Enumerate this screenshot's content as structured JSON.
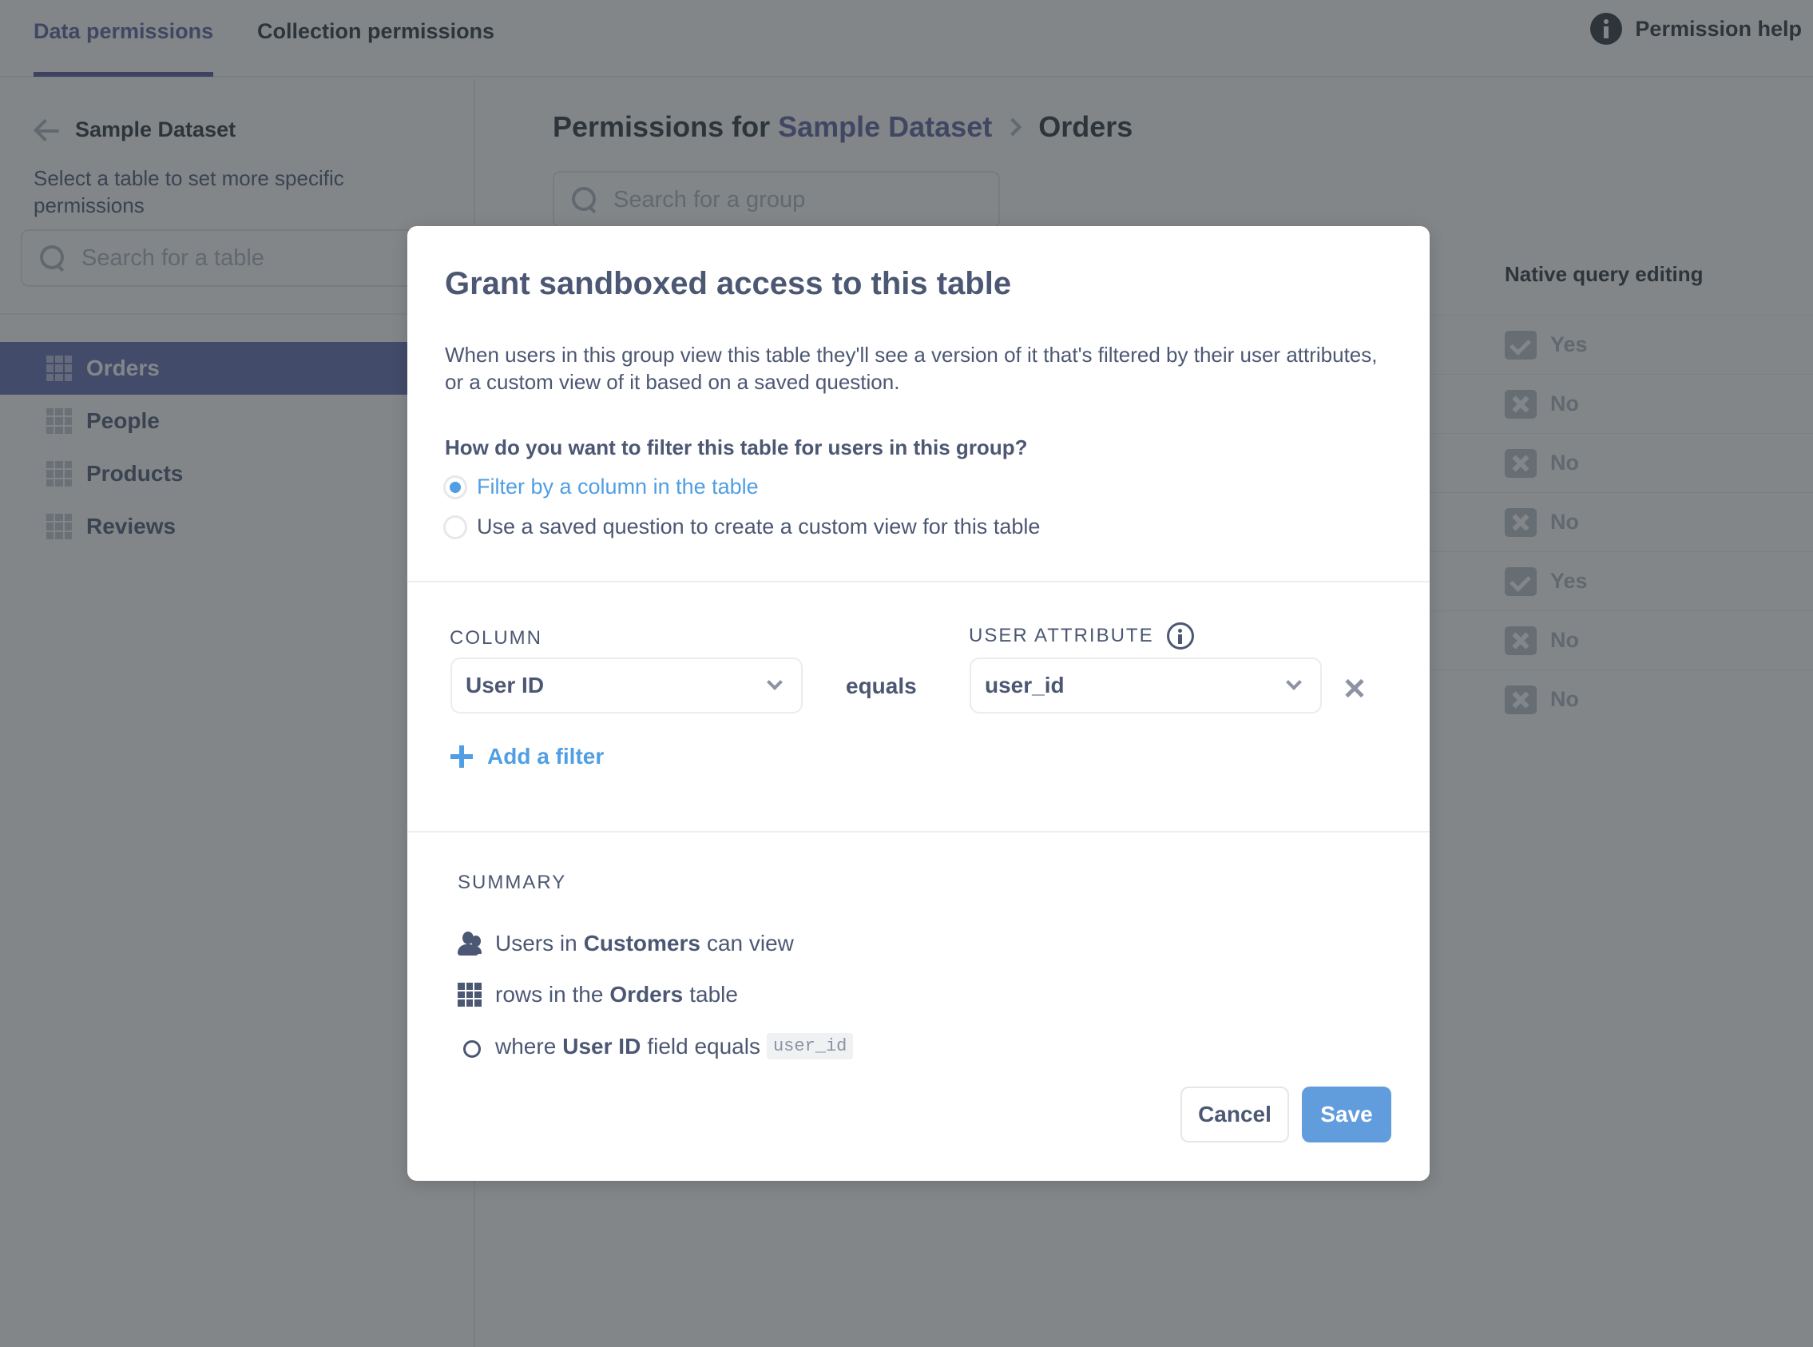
{
  "topnav": {
    "tabs": [
      {
        "label": "Data permissions",
        "active": true
      },
      {
        "label": "Collection permissions",
        "active": false
      }
    ],
    "help_label": "Permission help",
    "help_icon": "info-icon"
  },
  "sidebar": {
    "back_label": "Sample Dataset",
    "description": "Select a table to set more specific permissions",
    "search_placeholder": "Search for a table",
    "tables": [
      {
        "label": "Orders",
        "active": true,
        "icon": "table-grid-icon"
      },
      {
        "label": "People",
        "active": false,
        "icon": "table-grid-icon"
      },
      {
        "label": "Products",
        "active": false,
        "icon": "table-grid-icon"
      },
      {
        "label": "Reviews",
        "active": false,
        "icon": "table-grid-icon"
      }
    ]
  },
  "main": {
    "title_prefix": "Permissions for",
    "title_database": "Sample Dataset",
    "title_table": "Orders",
    "group_search_placeholder": "Search for a group",
    "column_header": "Native query editing",
    "native_query_values": [
      "Yes",
      "No",
      "No",
      "No",
      "Yes",
      "No",
      "No"
    ]
  },
  "modal": {
    "title": "Grant sandboxed access to this table",
    "description": "When users in this group view this table they'll see a version of it that's filtered by their user attributes, or a custom view of it based on a saved question.",
    "question": "How do you want to filter this table for users in this group?",
    "options": [
      {
        "label": "Filter by a column in the table",
        "selected": true
      },
      {
        "label": "Use a saved question to create a custom view for this table",
        "selected": false
      }
    ],
    "column_label": "COLUMN",
    "column_value": "User ID",
    "operator": "equals",
    "user_attribute_label": "USER ATTRIBUTE",
    "user_attribute_value": "user_id",
    "add_filter_label": "Add a filter",
    "summary_label": "SUMMARY",
    "summary": {
      "row1_pre": "Users in",
      "row1_bold": "Customers",
      "row1_post": "can view",
      "row2_pre": "rows in the",
      "row2_bold": "Orders",
      "row2_post": "table",
      "row3_pre": "where",
      "row3_bold": "User ID",
      "row3_post": "field equals",
      "row3_code": "user_id"
    },
    "cancel_label": "Cancel",
    "save_label": "Save"
  },
  "colors": {
    "brand": "#509ee3",
    "nav_accent": "#50569a",
    "text_dark": "#4c5773",
    "save_button": "#619ddd"
  }
}
